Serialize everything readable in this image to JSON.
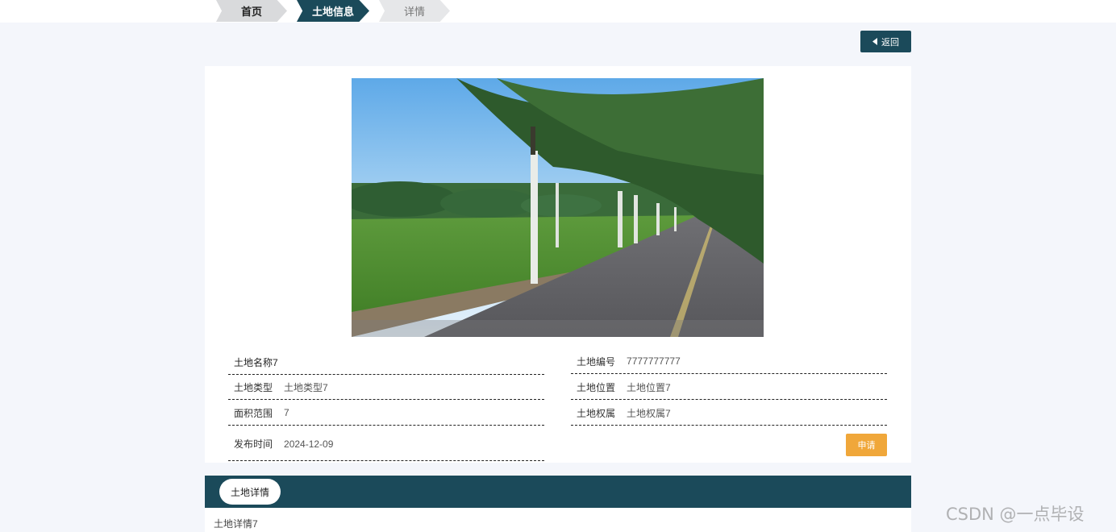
{
  "breadcrumb": {
    "home": "首页",
    "land_info": "土地信息",
    "detail": "详情"
  },
  "actions": {
    "back_label": "返回",
    "apply_label": "申请"
  },
  "land": {
    "name_label": "土地名称7",
    "type_label": "土地类型",
    "type_value": "土地类型7",
    "area_label": "面积范围",
    "area_value": "7",
    "publish_label": "发布时间",
    "publish_value": "2024-12-09",
    "code_label": "土地编号",
    "code_value": "7777777777",
    "location_label": "土地位置",
    "location_value": "土地位置7",
    "ownership_label": "土地权属",
    "ownership_value": "土地权属7"
  },
  "tabs": {
    "active": "土地详情"
  },
  "detail_content": "土地详情7",
  "watermark": "CSDN @一点毕设",
  "colors": {
    "primary": "#1b4a5a",
    "accent": "#f0a73a",
    "background": "#f4f6fb"
  }
}
